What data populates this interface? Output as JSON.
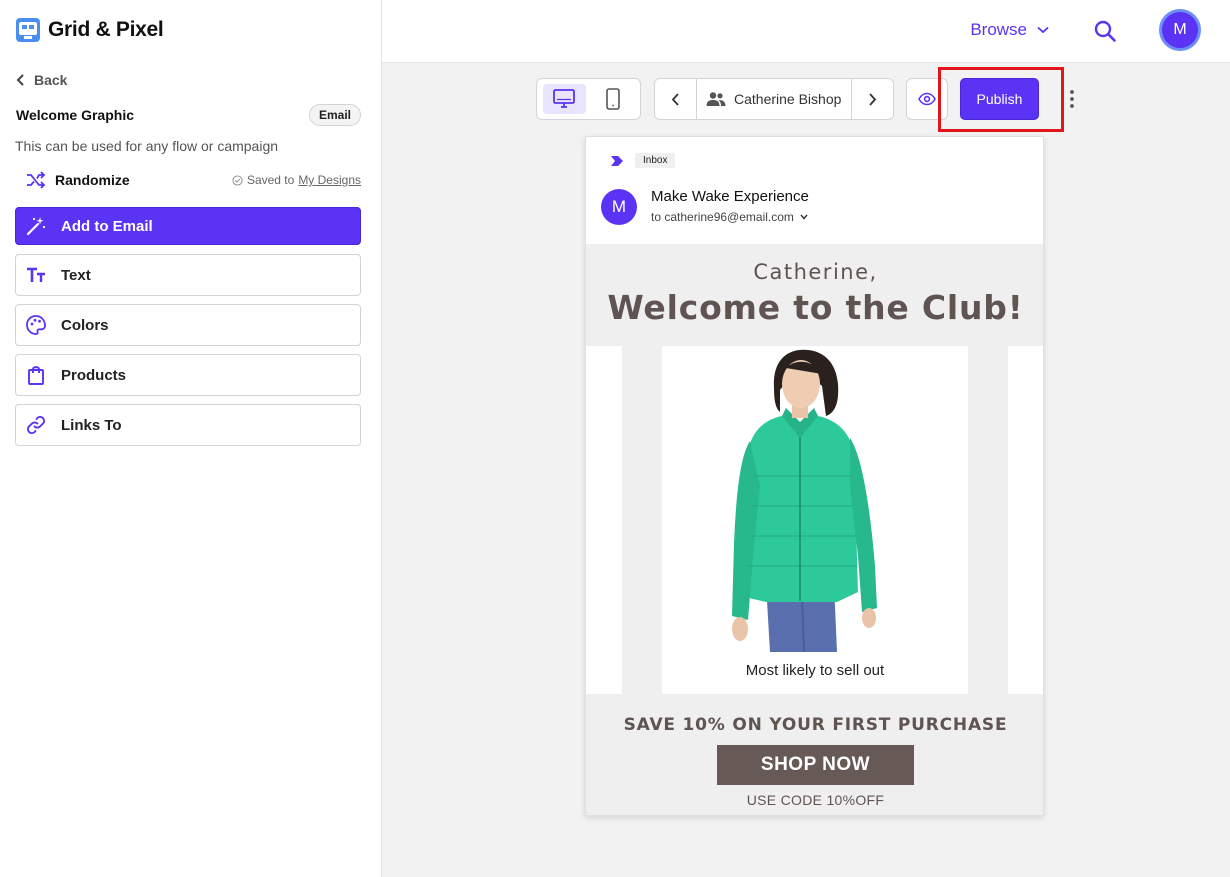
{
  "app": {
    "name": "Grid & Pixel"
  },
  "sidebar": {
    "back_label": "Back",
    "design_title": "Welcome Graphic",
    "design_type_badge": "Email",
    "description": "This can be used for any flow or campaign",
    "randomize_label": "Randomize",
    "saved_prefix": "Saved to",
    "saved_link": "My Designs",
    "actions": [
      {
        "label": "Add to Email",
        "icon": "magic-wand-icon"
      },
      {
        "label": "Text",
        "icon": "text-icon"
      },
      {
        "label": "Colors",
        "icon": "palette-icon"
      },
      {
        "label": "Products",
        "icon": "shopping-bag-icon"
      },
      {
        "label": "Links To",
        "icon": "link-icon"
      }
    ]
  },
  "header": {
    "browse_label": "Browse",
    "avatar_initial": "M"
  },
  "toolbar": {
    "active_device": "desktop",
    "recipient_name": "Catherine Bishop",
    "publish_label": "Publish",
    "highlighted_element": "publish"
  },
  "email_preview": {
    "inbox_tag": "Inbox",
    "sender_initial": "M",
    "sender_name": "Make Wake Experience",
    "to_line": "to catherine96@email.com",
    "greeting": "Catherine,",
    "headline": "Welcome to the Club!",
    "product_caption": "Most likely to sell out",
    "offer": "SAVE 10% ON YOUR FIRST PURCHASE",
    "cta": "SHOP NOW",
    "code_line": "USE CODE 10%OFF"
  },
  "colors": {
    "accent": "#5a33f5",
    "highlight_box": "#e0161c",
    "email_text": "#5f5452",
    "cta_bg": "#675956",
    "jacket": "#2ec99a"
  }
}
